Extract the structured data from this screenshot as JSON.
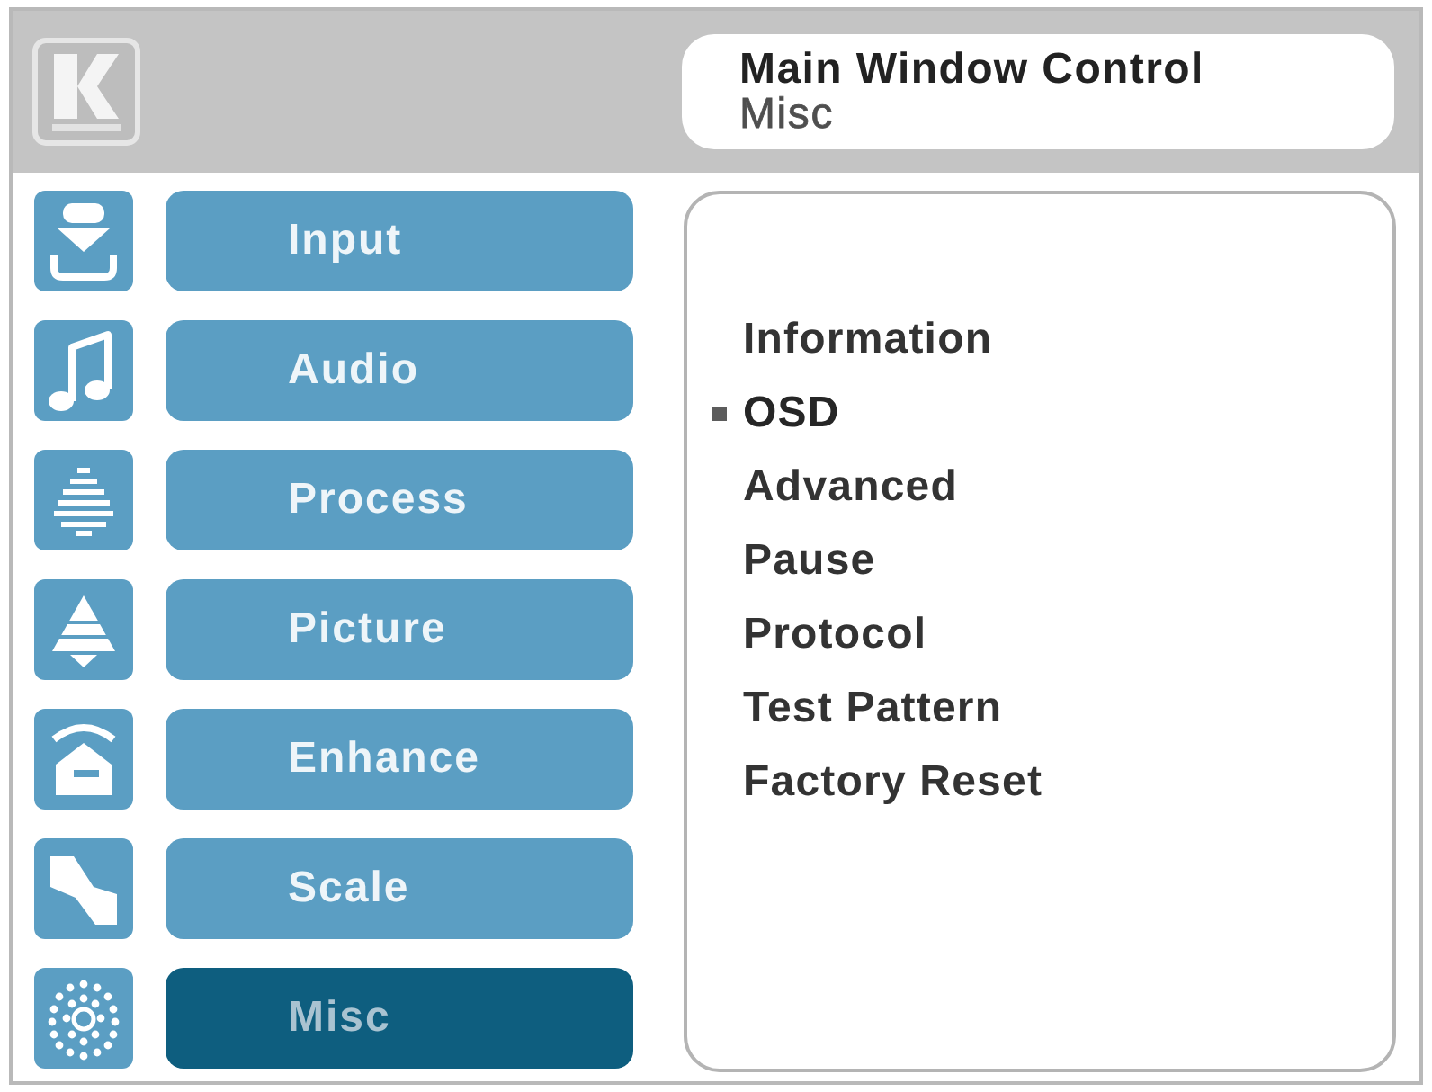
{
  "header": {
    "title": "Main Window Control",
    "subtitle": "Misc"
  },
  "sidebar": {
    "items": [
      {
        "label": "Input",
        "selected": false
      },
      {
        "label": "Audio",
        "selected": false
      },
      {
        "label": "Process",
        "selected": false
      },
      {
        "label": "Picture",
        "selected": false
      },
      {
        "label": "Enhance",
        "selected": false
      },
      {
        "label": "Scale",
        "selected": false
      },
      {
        "label": "Misc",
        "selected": true
      }
    ]
  },
  "menu": {
    "items": [
      {
        "label": "Information",
        "selected": false
      },
      {
        "label": "OSD",
        "selected": true
      },
      {
        "label": "Advanced",
        "selected": false
      },
      {
        "label": "Pause",
        "selected": false
      },
      {
        "label": "Protocol",
        "selected": false
      },
      {
        "label": "Test Pattern",
        "selected": false
      },
      {
        "label": "Factory Reset",
        "selected": false
      }
    ]
  }
}
